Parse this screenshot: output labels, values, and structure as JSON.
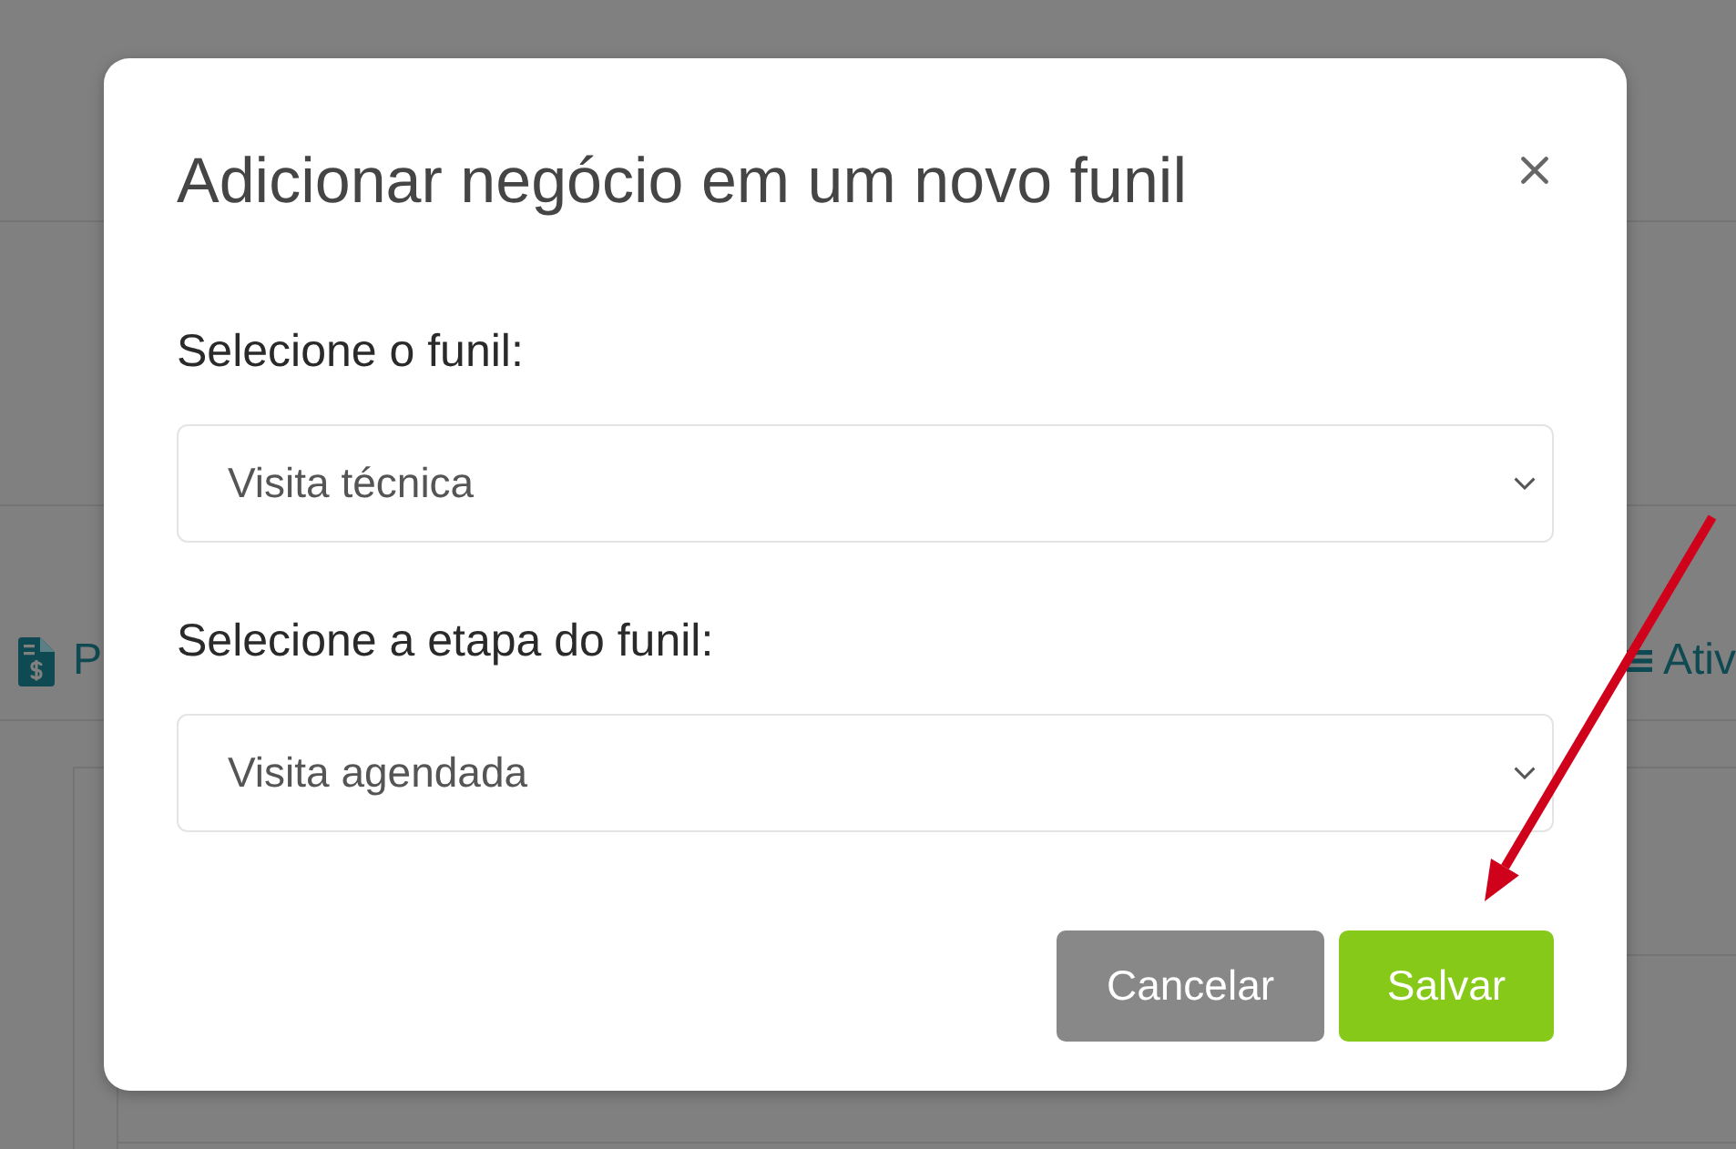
{
  "background_page": {
    "tabs": [
      {
        "kind": "document",
        "label": "P"
      },
      {
        "kind": "list",
        "label": "Ativ"
      }
    ]
  },
  "dialog": {
    "title": "Adicionar negócio em um novo funil",
    "fields": [
      {
        "label": "Selecione o funil:",
        "value": "Visita técnica"
      },
      {
        "label": "Selecione a etapa do funil:",
        "value": "Visita agendada"
      }
    ],
    "buttons": [
      {
        "kind": "secondary",
        "label": "Cancelar"
      },
      {
        "kind": "primary",
        "label": "Salvar"
      }
    ]
  },
  "annotation": {
    "kind": "arrow"
  }
}
